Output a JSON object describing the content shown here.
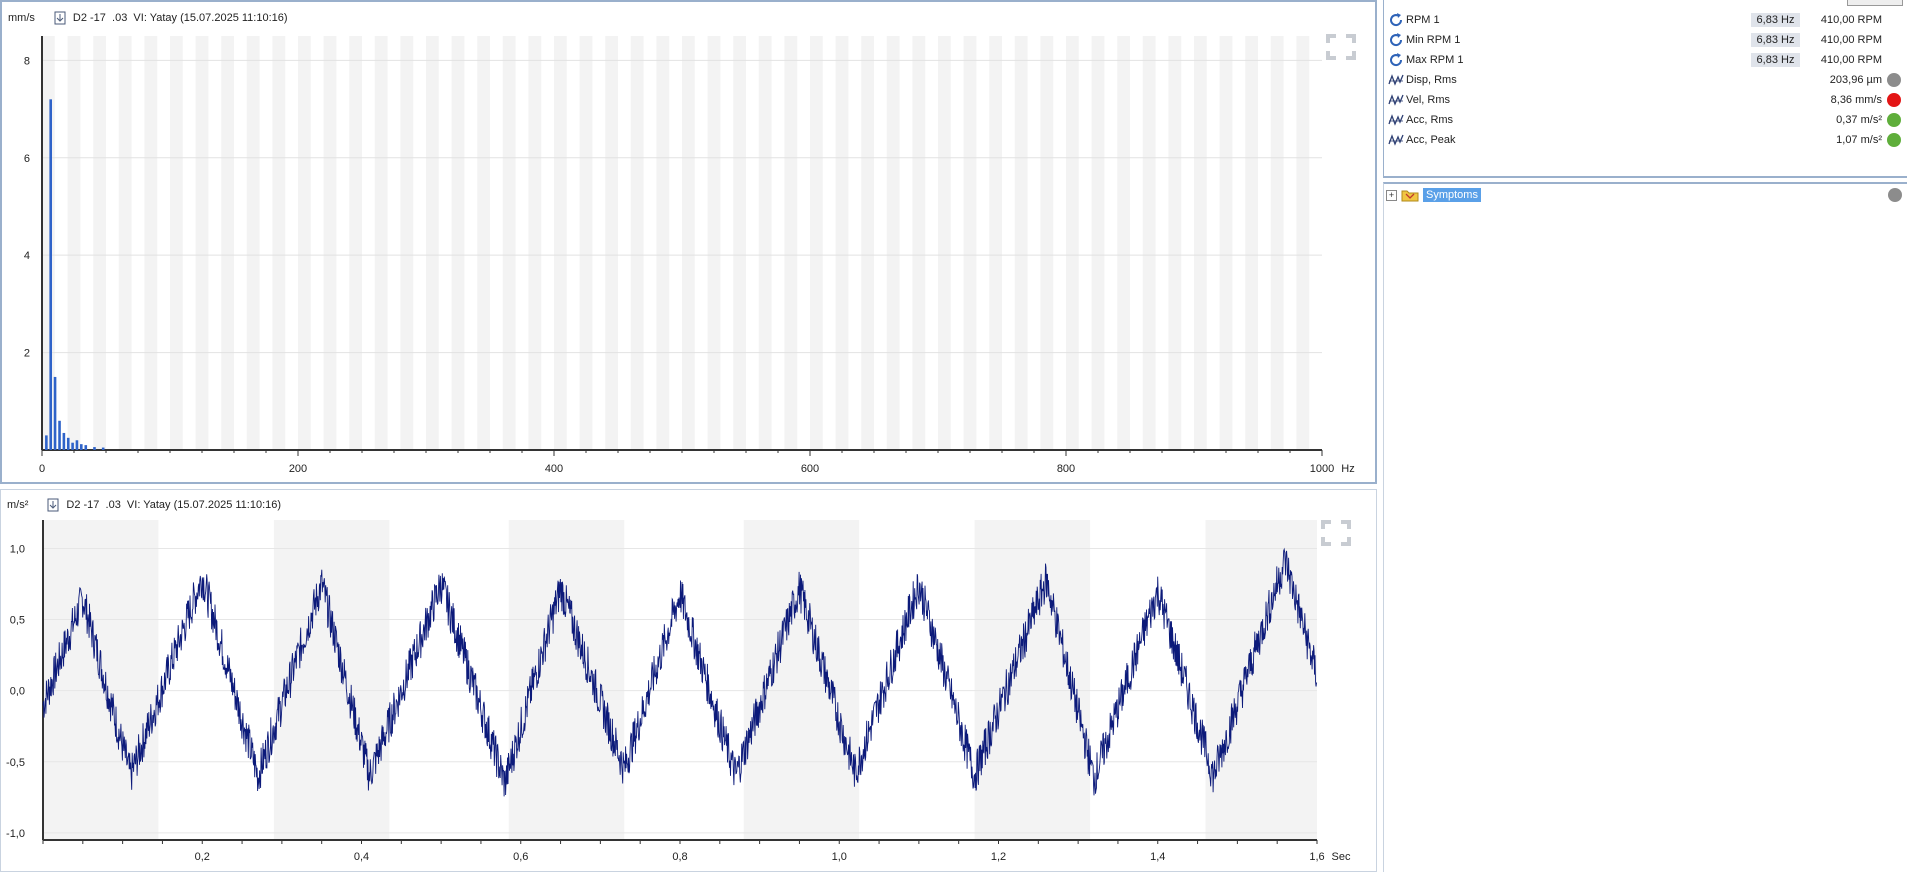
{
  "spectrum": {
    "unit": "mm/s",
    "title": "D2 -17  .03  VI: Yatay (15.07.2025 11:10:16)",
    "xunit": "Hz"
  },
  "waveform": {
    "unit": "m/s²",
    "title": "D2 -17  .03  VI: Yatay (15.07.2025 11:10:16)",
    "xunit": "Sec"
  },
  "measurements": [
    {
      "icon": "rpm-icon",
      "label": "RPM 1",
      "hz": "6,83 Hz",
      "value": "410,00 RPM",
      "status": ""
    },
    {
      "icon": "rpm-icon",
      "label": "Min RPM 1",
      "hz": "6,83 Hz",
      "value": "410,00 RPM",
      "status": ""
    },
    {
      "icon": "rpm-icon",
      "label": "Max RPM 1",
      "hz": "6,83 Hz",
      "value": "410,00 RPM",
      "status": ""
    },
    {
      "icon": "waveform-icon",
      "label": "Disp, Rms",
      "hz": "",
      "value": "203,96 µm",
      "status": "#8c8c8c"
    },
    {
      "icon": "waveform-icon",
      "label": "Vel, Rms",
      "hz": "",
      "value": "8,36 mm/s",
      "status": "#e31515"
    },
    {
      "icon": "waveform-icon",
      "label": "Acc, Rms",
      "hz": "",
      "value": "0,37 m/s²",
      "status": "#5fae3b"
    },
    {
      "icon": "waveform-icon",
      "label": "Acc, Peak",
      "hz": "",
      "value": "1,07 m/s²",
      "status": "#5fae3b"
    }
  ],
  "symptoms": {
    "label": "Symptoms",
    "status": "#8c8c8c"
  },
  "colors": {
    "spectrum_bar": "#2f63c9",
    "waveform_line": "#0c1a7a",
    "grid_band": "#f3f3f3"
  },
  "chart_data": [
    {
      "type": "bar",
      "xlabel": "Hz",
      "ylabel": "mm/s",
      "xlim": [
        0,
        1000
      ],
      "ylim": [
        0,
        8.5
      ],
      "xticks": [
        0,
        200,
        400,
        600,
        800,
        1000
      ],
      "yticks": [
        2,
        4,
        6,
        8
      ],
      "x": [
        3.4,
        6.8,
        10.2,
        13.7,
        17.1,
        20.5,
        23.9,
        27.3,
        30.7,
        34.2,
        41.0,
        47.8
      ],
      "values": [
        0.3,
        7.2,
        1.5,
        0.6,
        0.35,
        0.25,
        0.15,
        0.2,
        0.12,
        0.1,
        0.06,
        0.05
      ],
      "grid": true
    },
    {
      "type": "line",
      "xlabel": "Sec",
      "ylabel": "m/s²",
      "xlim": [
        0,
        1.6
      ],
      "ylim": [
        -1.05,
        1.2
      ],
      "xticks": [
        0.2,
        0.4,
        0.6,
        0.8,
        1.0,
        1.2,
        1.4,
        1.6
      ],
      "xtick_labels": [
        "0,2",
        "0,4",
        "0,6",
        "0,8",
        "1,0",
        "1,2",
        "1,4",
        "1,6"
      ],
      "yticks": [
        -1.0,
        -0.5,
        0.0,
        0.5,
        1.0
      ],
      "ytick_labels": [
        "-1,0",
        "-0,5",
        "0,0",
        "0,5",
        "1,0"
      ],
      "series": [
        {
          "x": [
            0.0,
            0.05,
            0.11,
            0.2,
            0.27,
            0.35,
            0.41,
            0.5,
            0.58,
            0.65,
            0.73,
            0.8,
            0.87,
            0.95,
            1.02,
            1.1,
            1.17,
            1.26,
            1.32,
            1.4,
            1.47,
            1.56,
            1.6
          ],
          "values": [
            -0.1,
            0.65,
            -0.6,
            0.8,
            -0.6,
            0.75,
            -0.6,
            0.75,
            -0.65,
            0.72,
            -0.55,
            0.68,
            -0.6,
            0.72,
            -0.58,
            0.75,
            -0.6,
            0.78,
            -0.62,
            0.7,
            -0.6,
            0.92,
            0.1
          ]
        }
      ],
      "grid": true
    }
  ]
}
